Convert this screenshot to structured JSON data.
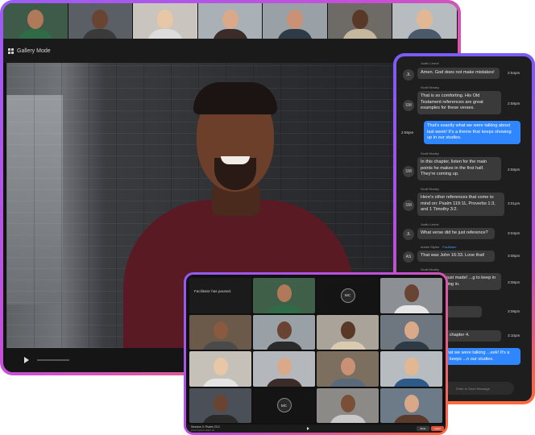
{
  "main_window": {
    "mode_label": "Gallery Mode"
  },
  "chat": {
    "messages": [
      {
        "sender": "Justin Leone",
        "initials": "JL",
        "text": "Amen. God does not make mistakes!",
        "time": "2:54pm"
      },
      {
        "sender": "Scott Mosley",
        "initials": "SM",
        "text": "That is so comforting. His Old Testament references are great examples for these verses.",
        "time": "2:59pm"
      },
      {
        "sender": "",
        "initials": "",
        "text": "That's exactly what we were talking about last week! It's a theme that keeps showing up in our studies.",
        "time": "2:59pm",
        "mine": true
      },
      {
        "sender": "Scott Mosley",
        "initials": "SM",
        "text": "In this chapter, listen for the main points he makes in the first half. They're coming up.",
        "time": "2:59pm"
      },
      {
        "sender": "Scott Mosley",
        "initials": "SM",
        "text": "Here's other references that come to mind on: Psalm 119:11, Proverbs 1:3, and 1 Timothy 3:2.",
        "time": "3:01pm"
      },
      {
        "sender": "Justin Leone",
        "initials": "JL",
        "text": "What verse did he just reference?",
        "time": "3:04pm"
      },
      {
        "sender": "Austin Styles",
        "tag": "Facilitator",
        "initials": "AS",
        "text": "That was John 16:33. Love that!",
        "time": "3:08pm"
      },
      {
        "sender": "Scott Mosley",
        "initials": "",
        "text": "...at point he just made! ...g to keep in mind in the ...ing in.",
        "time": "3:08pm"
      },
      {
        "sender": "",
        "initials": "",
        "text": "...t reminder.",
        "time": "3:09pm"
      },
      {
        "sender": "",
        "initials": "",
        "text": "...that more in chapter 4.",
        "time": "3:10pm"
      },
      {
        "sender": "",
        "initials": "",
        "text": "...xactly what we were talking ...eek! It's a theme that keeps ...n our studies.",
        "time": "",
        "mine": true
      }
    ],
    "input_hint": "Enter to Send Message"
  },
  "tablet": {
    "paused_text": "Facilitator has paused.",
    "mc_initials_1": "MC",
    "mc_initials_2": "MC",
    "session_title": "Session 3: Psalm 23:2",
    "session_subtitle": "Lorem Ipsum dolor sit",
    "btn_left": "Mute",
    "btn_right": "Leave"
  },
  "colors": {
    "accent_start": "#9b5cf6",
    "accent_end": "#ff6a3d",
    "my_bubble": "#2f86ff",
    "other_bubble": "#3a3a3a",
    "panel_bg": "#1e1e1e"
  }
}
